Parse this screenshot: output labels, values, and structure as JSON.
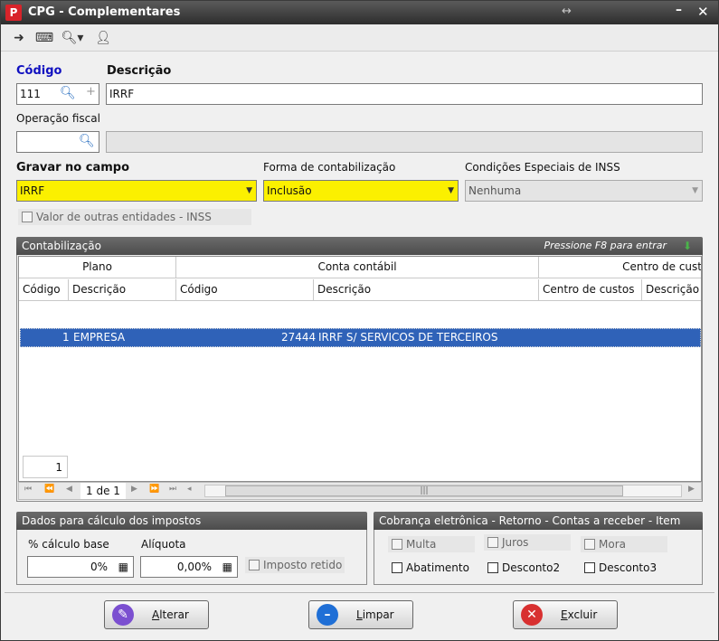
{
  "window": {
    "title": "CPG - Complementares",
    "app_icon_glyph": "P"
  },
  "toolbar": {
    "icons": [
      "exit-icon",
      "keyboard-icon",
      "search-icon",
      "user-icon"
    ]
  },
  "form": {
    "codigo_label": "Código",
    "descricao_label": "Descrição",
    "codigo_value": "111",
    "descricao_value": "IRRF",
    "operacao_label": "Operação fiscal",
    "operacao_value": "",
    "operacao_desc_value": "",
    "gravar_label": "Gravar no campo",
    "gravar_value": "IRRF",
    "forma_label": "Forma de contabilização",
    "forma_value": "Inclusão",
    "condicoes_label": "Condições Especiais de INSS",
    "condicoes_value": "Nenhuma",
    "valor_outras_label": "Valor de outras entidades - INSS"
  },
  "contabilizacao": {
    "title": "Contabilização",
    "hint": "Pressione F8 para entrar",
    "group_headers": {
      "plano": "Plano",
      "conta": "Conta contábil",
      "centro": "Centro de cust"
    },
    "columns": {
      "plano_codigo": "Código",
      "plano_descricao": "Descrição",
      "conta_codigo": "Código",
      "conta_descricao": "Descrição",
      "centro_custos": "Centro de custos",
      "centro_descricao": "Descrição"
    },
    "rows": [
      {
        "plano_codigo": "1",
        "plano_descricao": "EMPRESA",
        "conta_codigo": "27444",
        "conta_descricao": "IRRF S/ SERVICOS DE TERCEIROS"
      }
    ],
    "footer_count": "1",
    "navigator_position": "1 de 1"
  },
  "impostos": {
    "title": "Dados para cálculo dos impostos",
    "calculo_base_label": "% cálculo base",
    "calculo_base_value": "0%",
    "aliquota_label": "Alíquota",
    "aliquota_value": "0,00%",
    "imposto_retido_label": "Imposto retido"
  },
  "cobranca": {
    "title": "Cobrança eletrônica - Retorno - Contas a receber - Item",
    "multa": "Multa",
    "juros": "Juros",
    "mora": "Mora",
    "abatimento": "Abatimento",
    "desconto2": "Desconto2",
    "desconto3": "Desconto3"
  },
  "buttons": {
    "alterar_first": "A",
    "alterar_rest": "lterar",
    "limpar_first": "L",
    "limpar_rest": "impar",
    "excluir_first": "E",
    "excluir_rest": "xcluir"
  },
  "colors": {
    "titlebar": "#3f3f3f",
    "required_field": "#fbf000",
    "selection_row": "#2f62b8",
    "section_header": "#5c5c5c"
  }
}
